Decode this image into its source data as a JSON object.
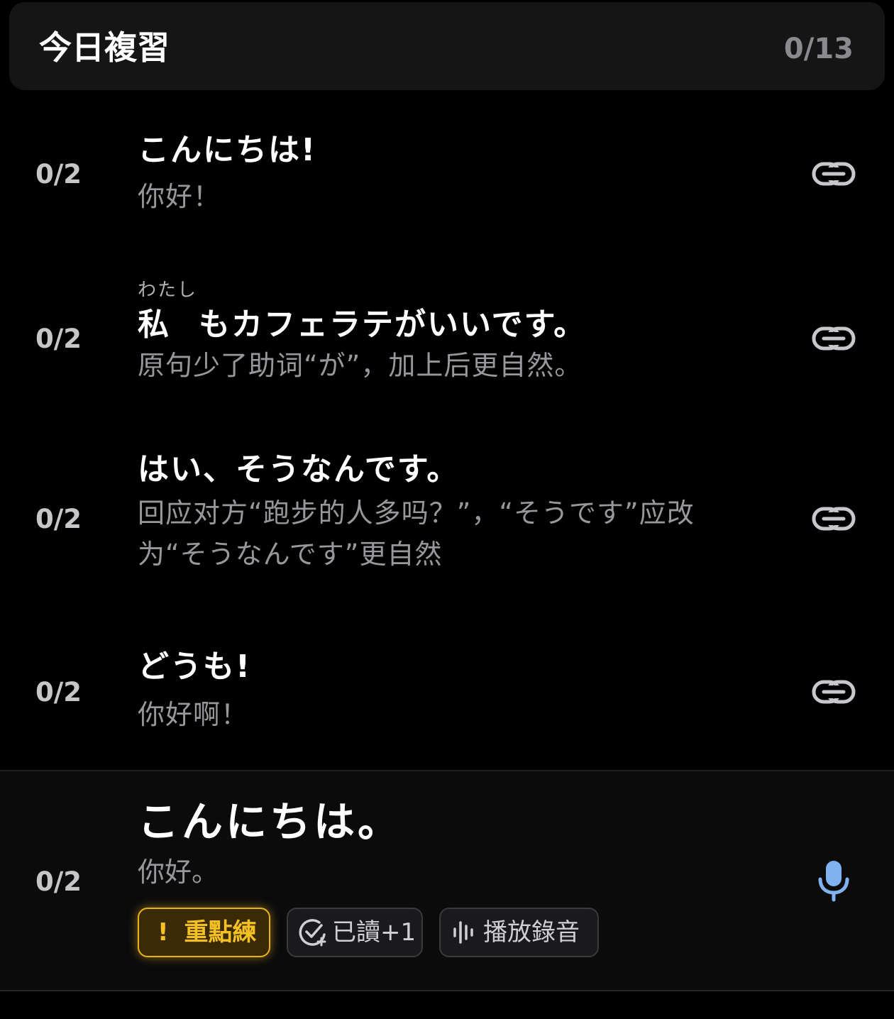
{
  "header": {
    "title": "今日複習",
    "progress": "0/13"
  },
  "items": [
    {
      "count": "0/2",
      "japanese": "こんにちは!",
      "chinese": "你好！"
    },
    {
      "count": "0/2",
      "ruby": "わたし",
      "japanese_kanji": "私",
      "japanese_rest": "もカフェラテがいいです。",
      "chinese": "原句少了助词“が”，加上后更自然。"
    },
    {
      "count": "0/2",
      "japanese": "はい、そうなんです。",
      "chinese_line1": "回应对方“跑步的人多吗？”，“そうです”应改",
      "chinese_line2": "为“そうなんです”更自然"
    },
    {
      "count": "0/2",
      "japanese": "どうも!",
      "chinese": "你好啊！"
    }
  ],
  "current": {
    "count": "0/2",
    "japanese": "こんにちは。",
    "chinese": "你好。",
    "actions": {
      "focus_icon": "!",
      "focus_label": "重點練",
      "read_label": "已讀+1",
      "play_label": "播放錄音"
    }
  },
  "colors": {
    "background": "#000000",
    "header_bg": "#151516",
    "focus_accent": "#f5c023",
    "mic_accent": "#7fb2ee"
  },
  "icons": {
    "row_action": "link-icon",
    "record": "microphone-icon",
    "read": "check-circle-plus-icon",
    "play": "waveform-icon"
  }
}
